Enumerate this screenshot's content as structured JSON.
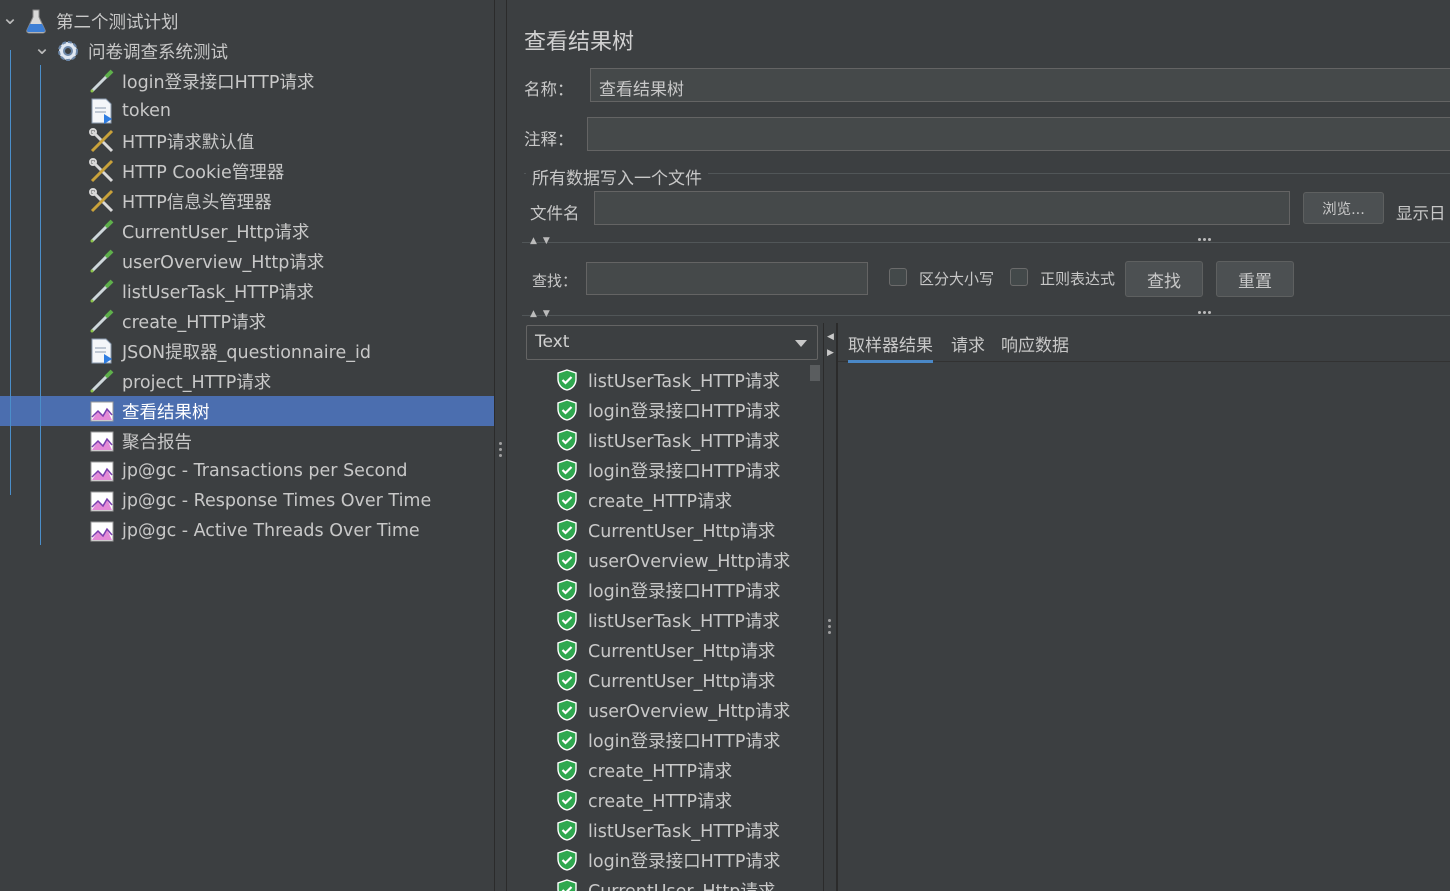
{
  "tree": {
    "items": [
      {
        "label": "第二个测试计划",
        "icon": "test-plan-icon",
        "level": 0
      },
      {
        "label": "问卷调查系统测试",
        "icon": "thread-group-gear-icon",
        "level": 1
      },
      {
        "label": "login登录接口HTTP请求",
        "icon": "http-sampler-pipette-icon",
        "level": 2
      },
      {
        "label": "token",
        "icon": "extractor-document-icon",
        "level": 2
      },
      {
        "label": "HTTP请求默认值",
        "icon": "config-tools-icon",
        "level": 2
      },
      {
        "label": "HTTP Cookie管理器",
        "icon": "config-tools-icon",
        "level": 2
      },
      {
        "label": "HTTP信息头管理器",
        "icon": "config-tools-icon",
        "level": 2
      },
      {
        "label": "CurrentUser_Http请求",
        "icon": "http-sampler-pipette-icon",
        "level": 2
      },
      {
        "label": "userOverview_Http请求",
        "icon": "http-sampler-pipette-icon",
        "level": 2
      },
      {
        "label": "listUserTask_HTTP请求",
        "icon": "http-sampler-pipette-icon",
        "level": 2
      },
      {
        "label": "create_HTTP请求",
        "icon": "http-sampler-pipette-icon",
        "level": 2
      },
      {
        "label": "JSON提取器_questionnaire_id",
        "icon": "extractor-document-icon",
        "level": 2
      },
      {
        "label": "project_HTTP请求",
        "icon": "http-sampler-pipette-icon",
        "level": 2
      },
      {
        "label": "查看结果树",
        "icon": "listener-graph-icon",
        "level": 2,
        "selected": true
      },
      {
        "label": "聚合报告",
        "icon": "listener-graph-icon",
        "level": 2
      },
      {
        "label": "jp@gc - Transactions per Second",
        "icon": "listener-graph-icon",
        "level": 2
      },
      {
        "label": "jp@gc - Response Times Over Time",
        "icon": "listener-graph-icon",
        "level": 2
      },
      {
        "label": "jp@gc - Active Threads Over Time",
        "icon": "listener-graph-icon",
        "level": 2
      }
    ]
  },
  "panel": {
    "title": "查看结果树",
    "name_label": "名称：",
    "name_value": "查看结果树",
    "comment_label": "注释：",
    "comment_value": "",
    "file_group_title": "所有数据写入一个文件",
    "filename_label": "文件名",
    "filename_value": "",
    "browse_button": "浏览...",
    "show_log_label": "显示日",
    "search_label": "查找：",
    "search_value": "",
    "case_sensitive_label": "区分大小写",
    "regex_label": "正则表达式",
    "find_button": "查找",
    "reset_button": "重置",
    "renderer_selected": "Text",
    "tabs": [
      "取样器结果",
      "请求",
      "响应数据"
    ],
    "active_tab": 0
  },
  "results": [
    "listUserTask_HTTP请求",
    "login登录接口HTTP请求",
    "listUserTask_HTTP请求",
    "login登录接口HTTP请求",
    "create_HTTP请求",
    "CurrentUser_Http请求",
    "userOverview_Http请求",
    "login登录接口HTTP请求",
    "listUserTask_HTTP请求",
    "CurrentUser_Http请求",
    "CurrentUser_Http请求",
    "userOverview_Http请求",
    "login登录接口HTTP请求",
    "create_HTTP请求",
    "create_HTTP请求",
    "listUserTask_HTTP请求",
    "login登录接口HTTP请求",
    "CurrentUser_Http请求"
  ],
  "colors": {
    "background": "#3c3f41",
    "selection": "#4b6eaf",
    "success_shield": "#2fa84f",
    "tab_underline": "#4a88c7"
  }
}
